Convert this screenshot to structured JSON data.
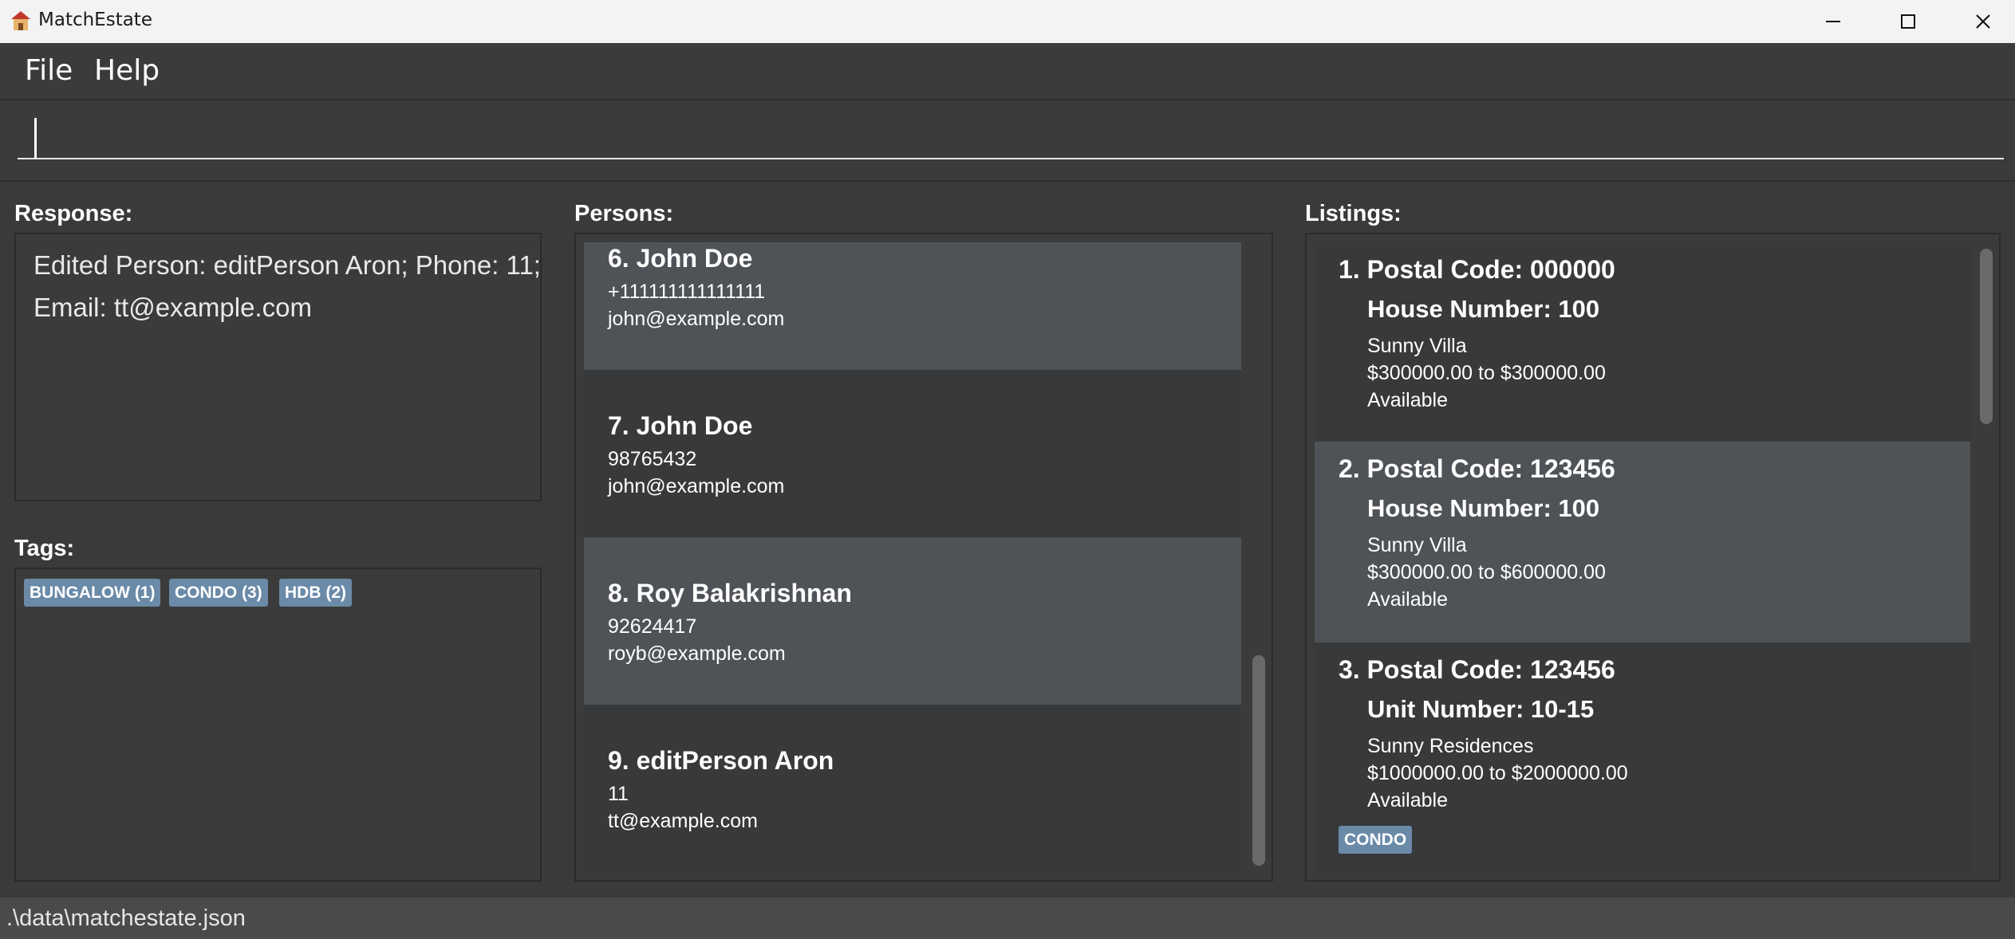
{
  "window": {
    "title": "MatchEstate",
    "icons": {
      "app": "house-icon",
      "minimize": "minimize-icon",
      "maximize": "maximize-icon",
      "close": "close-icon"
    }
  },
  "menu": {
    "file": "File",
    "help": "Help"
  },
  "command": {
    "value": "",
    "placeholder": ""
  },
  "response": {
    "label": "Response:",
    "text": "Edited Person: editPerson Aron; Phone: 11; Email: tt@example.com"
  },
  "tags": {
    "label": "Tags:",
    "items": [
      "BUNGALOW (1)",
      "CONDO (3)",
      "HDB (2)"
    ]
  },
  "persons": {
    "label": "Persons:",
    "items": [
      {
        "name": "6. John Doe",
        "phone": "+111111111111111",
        "email": "john@example.com"
      },
      {
        "name": "7. John Doe",
        "phone": "98765432",
        "email": "john@example.com"
      },
      {
        "name": "8. Roy Balakrishnan",
        "phone": "92624417",
        "email": "royb@example.com"
      },
      {
        "name": "9. editPerson Aron",
        "phone": "11",
        "email": "tt@example.com"
      }
    ]
  },
  "listings": {
    "label": "Listings:",
    "items": [
      {
        "title": "1. Postal Code: 000000",
        "unit": "House Number: 100",
        "name": "Sunny Villa",
        "price": "$300000.00 to $300000.00",
        "status": "Available",
        "tags": []
      },
      {
        "title": "2. Postal Code: 123456",
        "unit": "House Number: 100",
        "name": "Sunny Villa",
        "price": "$300000.00 to $600000.00",
        "status": "Available",
        "tags": []
      },
      {
        "title": "3. Postal Code: 123456",
        "unit": "Unit Number: 10-15",
        "name": "Sunny Residences",
        "price": "$1000000.00 to $2000000.00",
        "status": "Available",
        "tags": [
          "CONDO"
        ]
      }
    ]
  },
  "status": {
    "path": ".\\data\\matchestate.json"
  },
  "colors": {
    "background": "#3a3a3a",
    "card_dark": "#38393b",
    "card_light": "#4f5357",
    "tag": "#6a8aa8",
    "titlebar": "#f3f3f3"
  }
}
